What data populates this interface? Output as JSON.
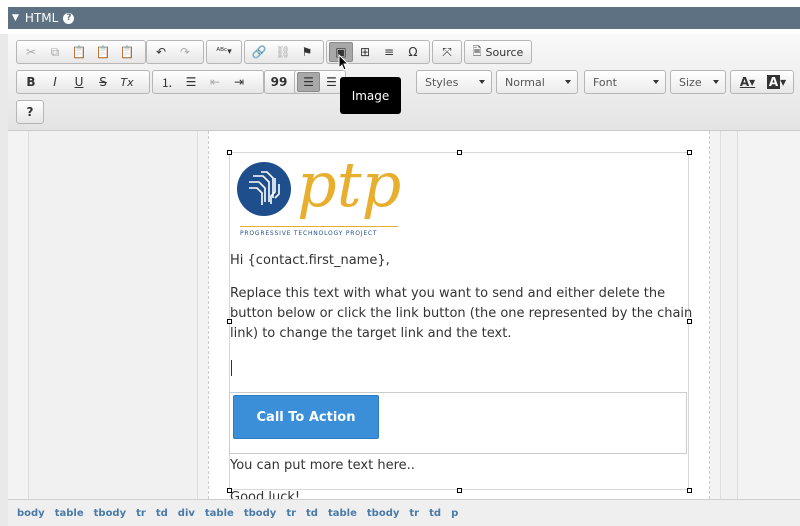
{
  "header": {
    "title": "HTML",
    "help_icon": "?"
  },
  "toolbar": {
    "row1_icons": [
      "cut-icon",
      "copy-icon",
      "paste-icon",
      "paste-text-icon",
      "paste-word-icon",
      "undo-icon",
      "redo-icon",
      "spellcheck-icon",
      "link-icon",
      "unlink-icon",
      "anchor-icon",
      "image-icon",
      "table-icon",
      "horizontal-rule-icon",
      "special-char-icon",
      "maximize-icon",
      "source-icon"
    ],
    "source_label": "Source",
    "row2_icons": [
      "bold-icon",
      "italic-icon",
      "underline-icon",
      "strikethrough-icon",
      "remove-format-icon",
      "numbered-list-icon",
      "bulleted-list-icon",
      "outdent-icon",
      "indent-icon",
      "blockquote-icon",
      "align-left-icon",
      "align-center-icon"
    ],
    "bold": "B",
    "italic": "I",
    "underline": "U",
    "strike": "S",
    "remove_format": "Tx",
    "quote": "99",
    "special_char": "Ω",
    "styles_label": "Styles",
    "format_label": "Normal",
    "font_label": "Font",
    "size_label": "Size",
    "text_color_label": "A",
    "bg_color_label": "A",
    "help_label": "?"
  },
  "tooltip": {
    "text": "Image"
  },
  "editor": {
    "logo_text": "ptp",
    "logo_subtitle": "PROGRESSIVE TECHNOLOGY PROJECT",
    "greeting": "Hi {contact.first_name},",
    "body_line1": "Replace this text with what you want to send and either delete the",
    "body_line2": "button below or click the link button (the one represented by the chain",
    "body_line3": "link) to change the target link and the text.",
    "cta_label": "Call To Action",
    "more_text": "You can put more text here..",
    "signoff": "Good luck!"
  },
  "colors": {
    "logo_blue": "#1f4e8c",
    "logo_gold": "#e8ae2e",
    "cta_blue": "#3a8fd8",
    "header_bar": "#5e7183"
  },
  "breadcrumb": [
    "body",
    "table",
    "tbody",
    "tr",
    "td",
    "div",
    "table",
    "tbody",
    "tr",
    "td",
    "table",
    "tbody",
    "tr",
    "td",
    "p"
  ]
}
